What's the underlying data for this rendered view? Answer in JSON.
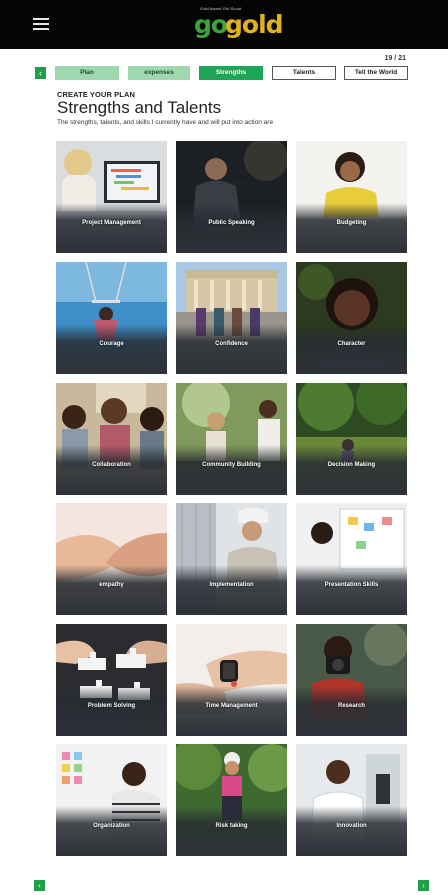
{
  "header": {
    "tagline": "Gold Award Girl Scout",
    "logo_go": "go",
    "logo_gold": "gold"
  },
  "progress": {
    "counter": "19 / 21"
  },
  "nav": {
    "prev_symbol": "‹",
    "next_symbol": "›",
    "tabs": [
      {
        "label": "Plan",
        "state": "done"
      },
      {
        "label": "expenses",
        "state": "done"
      },
      {
        "label": "Strengths",
        "state": "active"
      },
      {
        "label": "Talents",
        "state": "todo"
      },
      {
        "label": "Tell the World",
        "state": "todo"
      }
    ]
  },
  "intro": {
    "kicker": "CREATE YOUR PLAN",
    "title": "Strengths and Talents",
    "subtitle": "The strengths, talents, and skills I currently have and will put into action are"
  },
  "cards": [
    {
      "label": "Project Management"
    },
    {
      "label": "Public Speaking"
    },
    {
      "label": "Budgeting"
    },
    {
      "label": "Courage"
    },
    {
      "label": "Confidence"
    },
    {
      "label": "Character"
    },
    {
      "label": "Collaboration"
    },
    {
      "label": "Community Building"
    },
    {
      "label": "Decision Making"
    },
    {
      "label": "empathy"
    },
    {
      "label": "Implementation"
    },
    {
      "label": "Presentation Skills"
    },
    {
      "label": "Problem Solving"
    },
    {
      "label": "Time Management"
    },
    {
      "label": "Research"
    },
    {
      "label": "Organization"
    },
    {
      "label": "Risk taking"
    },
    {
      "label": "Innovation"
    }
  ],
  "colors": {
    "topbar": "#050505",
    "accent_green": "#1fa558",
    "done_tab": "#9fd8ae",
    "logo_green": "#3aa63a",
    "logo_gold": "#e0b31b"
  }
}
